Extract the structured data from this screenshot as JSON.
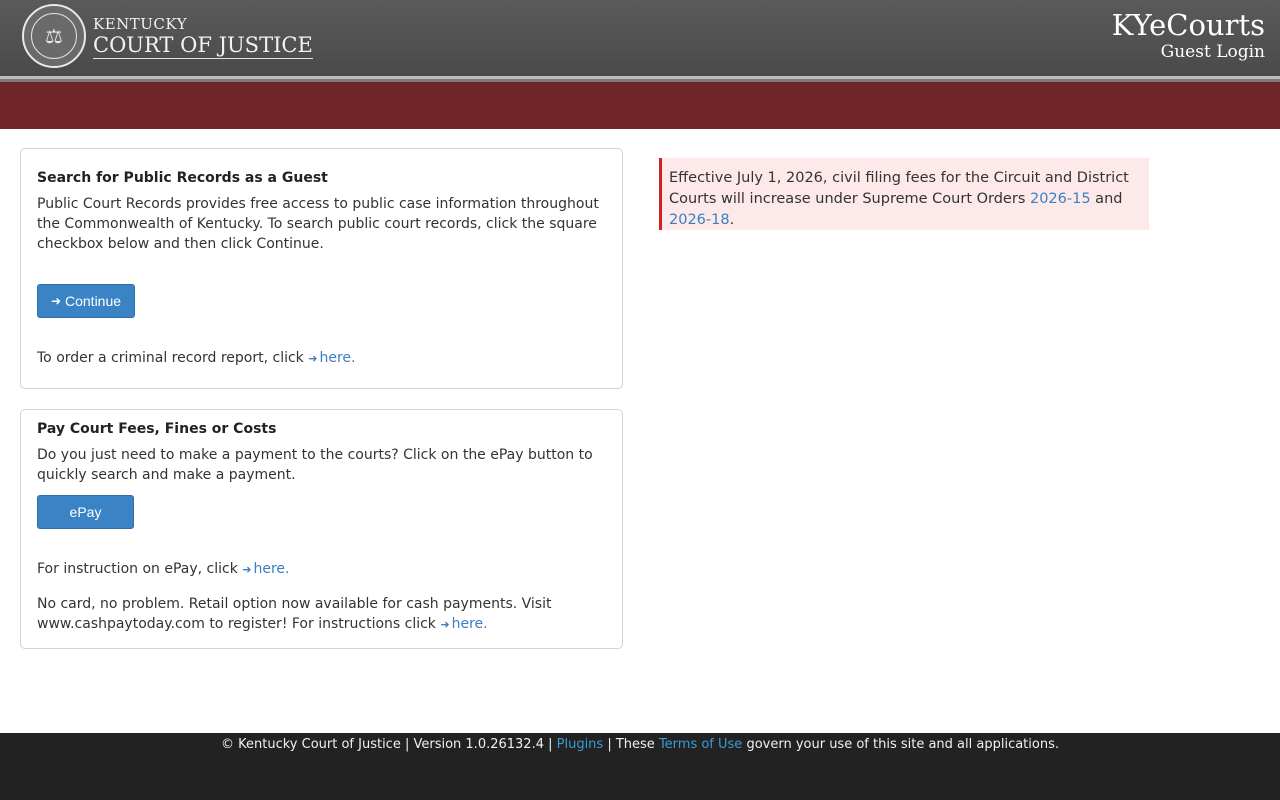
{
  "header": {
    "org_line1": "KENTUCKY",
    "org_line2": "COURT OF JUSTICE",
    "app_title": "KYeCourts",
    "app_subtitle": "Guest Login"
  },
  "guest_panel": {
    "title": "Search for Public Records as a Guest",
    "description": "Public Court Records provides free access to public case information throughout the Commonwealth of Kentucky. To search public court records, click the square checkbox below and then click Continue.",
    "continue_label": "Continue",
    "criminal_text": "To order a criminal record report, click",
    "criminal_link": "here."
  },
  "pay_panel": {
    "title": "Pay Court Fees, Fines or Costs",
    "description": "Do you just need to make a payment to the courts? Click on the ePay button to quickly search and make a payment.",
    "epay_label": "ePay",
    "instruction_text": "For instruction on ePay, click",
    "instruction_link": "here.",
    "cash_text": "No card, no problem. Retail option now available for cash payments. Visit www.cashpaytoday.com to register! For instructions click",
    "cash_link": "here."
  },
  "notice": {
    "text_before": "Effective July 1, 2026, civil filing fees for the Circuit and District Courts will increase under Supreme Court Orders ",
    "link1": "2026-15",
    "middle": " and ",
    "link2": "2026-18",
    "text_after": "."
  },
  "footer": {
    "copyright": "© Kentucky Court of Justice | Version 1.0.26132.4 | ",
    "plugins_link": "Plugins",
    "mid_text": " | These ",
    "terms_link": "Terms of Use",
    "end_text": " govern your use of this site and all applications."
  },
  "icons": {
    "seal": "court-seal-icon",
    "signin": "sign-in-icon"
  },
  "colors": {
    "header_bg": "#555555",
    "red_bar": "#6f2527",
    "button": "#3a83c5",
    "link": "#3a7fc0",
    "notice_bg": "#fde9e9",
    "notice_border": "#cf2027",
    "footer_bg": "#222222"
  }
}
